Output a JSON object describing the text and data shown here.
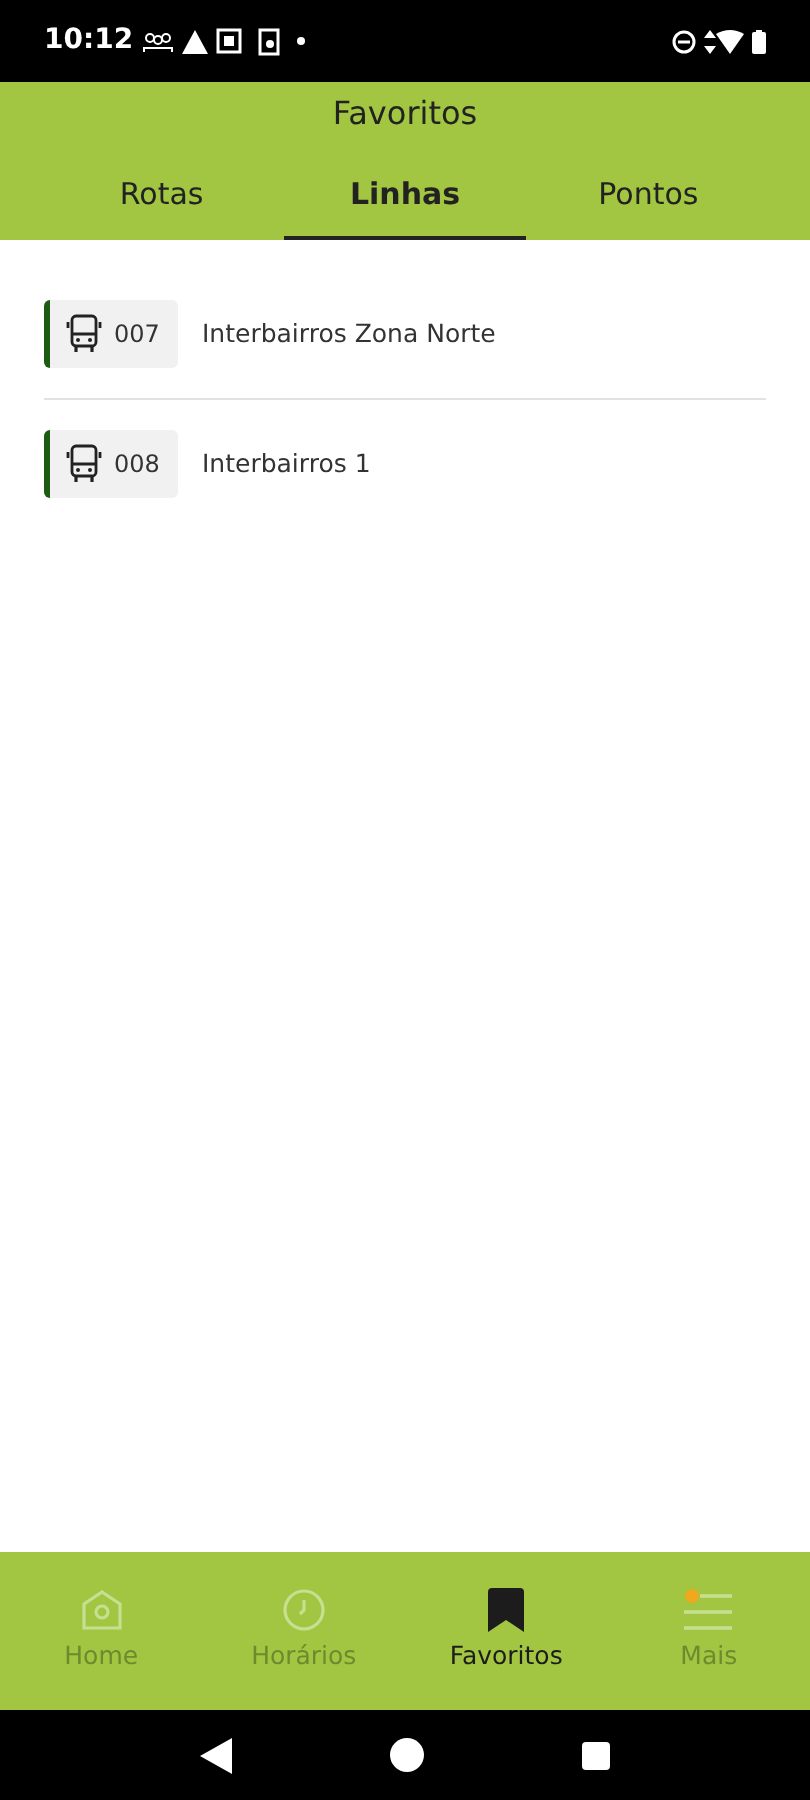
{
  "status_bar": {
    "time": "10:12"
  },
  "header": {
    "title": "Favoritos"
  },
  "tabs": [
    {
      "label": "Rotas",
      "selected": false
    },
    {
      "label": "Linhas",
      "selected": true
    },
    {
      "label": "Pontos",
      "selected": false
    }
  ],
  "lines": [
    {
      "code": "007",
      "name": "Interbairros Zona Norte"
    },
    {
      "code": "008",
      "name": "Interbairros 1"
    }
  ],
  "bottom_nav": [
    {
      "label": "Home",
      "kind": "home",
      "selected": false
    },
    {
      "label": "Horários",
      "kind": "clock",
      "selected": false
    },
    {
      "label": "Favoritos",
      "kind": "bookmark",
      "selected": true
    },
    {
      "label": "Mais",
      "kind": "menu",
      "selected": false
    }
  ]
}
